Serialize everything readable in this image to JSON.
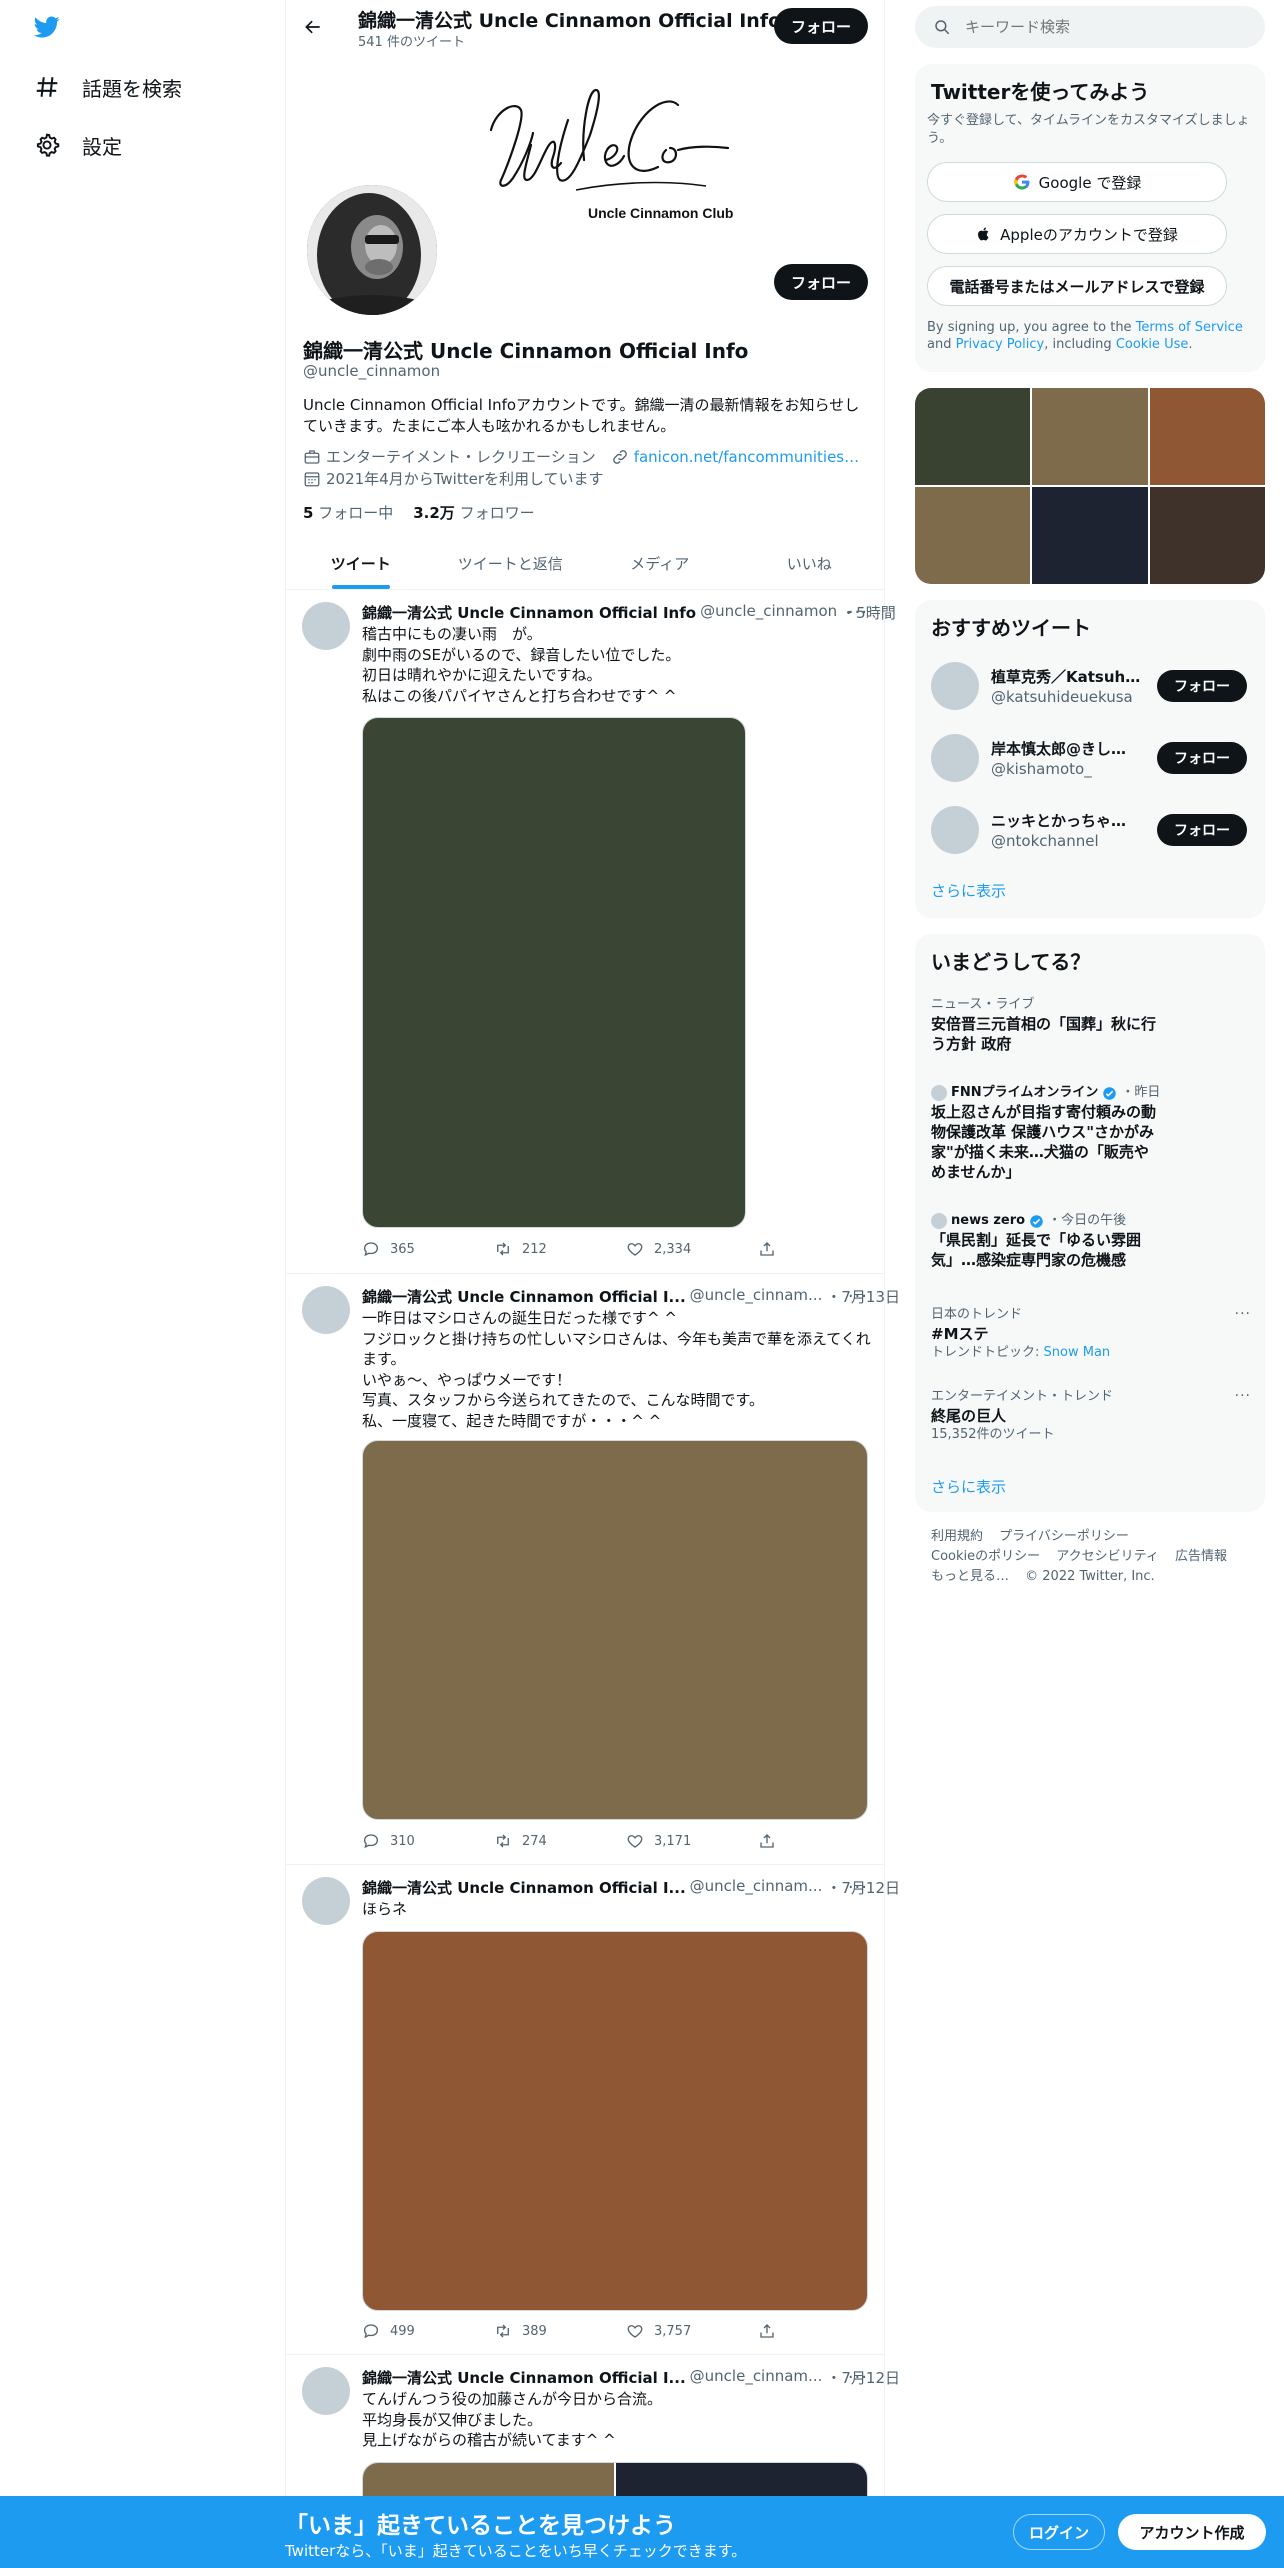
{
  "nav": {
    "items": [
      {
        "label": "話題を検索",
        "icon": "hashtag-icon"
      },
      {
        "label": "設定",
        "icon": "gear-icon"
      }
    ]
  },
  "header": {
    "name": "錦織一清公式 Uncle Cinnamon Official Info",
    "tweet_count": "541 件のツイート",
    "follow_label": "フォロー"
  },
  "banner": {
    "logo_text": "Uncle Cinnamon Club",
    "signature_text": "Uncle Co"
  },
  "profile": {
    "name": "錦織一清公式 Uncle Cinnamon Official Info",
    "handle": "@uncle_cinnamon",
    "bio": "Uncle Cinnamon Official Infoアカウントです。錦織一清の最新情報をお知らせしていきます。たまにご本人も呟かれるかもしれません。",
    "category": "エンターテイメント・レクリエーション",
    "url": "fanicon.net/fancommunities…",
    "joined": "2021年4月からTwitterを利用しています",
    "following_count": "5",
    "following_label": "フォロー中",
    "followers_count": "3.2万",
    "followers_label": "フォロワー",
    "follow_label": "フォロー"
  },
  "tabs": [
    "ツイート",
    "ツイートと返信",
    "メディア",
    "いいね"
  ],
  "tweets": [
    {
      "name": "錦織一清公式 Uncle Cinnamon Official Info",
      "handle": "@uncle_cinnamon",
      "time": "・5時間",
      "text": "稽古中にもの凄い雨　が。\n劇中雨のSEがいるので、録音したい位でした。\n初日は晴れやかに迎えたいですね。\n私はこの後パパイヤさんと打ち合わせです^ ^",
      "media_color": "#3b4533",
      "replies": "365",
      "retweets": "212",
      "likes": "2,334"
    },
    {
      "name": "錦織一清公式 Uncle Cinnamon Official I...",
      "handle": "@uncle_cinnam...",
      "time": "・7月13日",
      "text": "一昨日はマシロさんの誕生日だった様です^ ^\nフジロックと掛け持ちの忙しいマシロさんは、今年も美声で華を添えてくれます。\nいやぁ〜、やっぱウメーです！\n写真、スタッフから今送られてきたので、こんな時間です。\n私、一度寝て、起きた時間ですが・・・^ ^",
      "media_color": "#7d6b4c",
      "replies": "310",
      "retweets": "274",
      "likes": "3,171"
    },
    {
      "name": "錦織一清公式 Uncle Cinnamon Official I...",
      "handle": "@uncle_cinnam...",
      "time": "・7月12日",
      "text": "ほらネ",
      "media_color": "#8f5733",
      "replies": "499",
      "retweets": "389",
      "likes": "3,757"
    },
    {
      "name": "錦織一清公式 Uncle Cinnamon Official I...",
      "handle": "@uncle_cinnam...",
      "time": "・7月12日",
      "text": "てんげんつう役の加藤さんが今日から合流。\n平均身長が又伸びました。\n見上げながらの稽古が続いてます^ ^",
      "media_colors": [
        "#7d6b4c",
        "#1d2330"
      ]
    }
  ],
  "search": {
    "placeholder": "キーワード検索"
  },
  "signup_panel": {
    "title": "Twitterを使ってみよう",
    "subtitle": "今すぐ登録して、タイムラインをカスタマイズしましょう。",
    "google": "Google で登録",
    "apple": "Appleのアカウントで登録",
    "phone": "電話番号またはメールアドレスで登録",
    "terms_prefix": "By signing up, you agree to the ",
    "terms_link": "Terms of Service",
    "terms_and": " and ",
    "privacy_link": "Privacy Policy",
    "terms_including": ", including ",
    "cookie_link": "Cookie Use",
    "terms_end": "."
  },
  "media_grid": [
    "#394231",
    "#7d6b4c",
    "#8f5733",
    "#7d6b4c",
    "#1d2330",
    "#3e322a"
  ],
  "suggestions": {
    "title": "おすすめツイート",
    "items": [
      {
        "name": "植草克秀／Katsuhide...",
        "handle": "@katsuhideuekusa",
        "follow": "フォロー"
      },
      {
        "name": "岸本慎太郎@きしゃ...",
        "handle": "@kishamoto_",
        "follow": "フォロー"
      },
      {
        "name": "ニッキとかっちゃん...",
        "handle": "@ntokchannel",
        "follow": "フォロー"
      }
    ],
    "more": "さらに表示"
  },
  "trends": {
    "title": "いまどうしてる？",
    "items": [
      {
        "category": "ニュース・ライブ",
        "title": "安倍晋三元首相の「国葬」秋に行う方針 政府"
      },
      {
        "source": "FNNプライムオンライン",
        "time": "・昨日",
        "title": "坂上忍さんが目指す寄付頼みの動物保護改革 保護ハウス\"さかがみ家\"が描く未来…犬猫の「販売やめませんか」"
      },
      {
        "source": "news zero",
        "time": "・今日の午後",
        "title": "「県民割」延長で「ゆるい雰囲気」…感染症専門家の危機感"
      },
      {
        "category": "日本のトレンド",
        "title": "#Mステ",
        "sub_prefix": "トレンドトピック: ",
        "sub_link": "Snow Man"
      },
      {
        "category": "エンターテイメント・トレンド",
        "title": "終尾の巨人",
        "sub": "15,352件のツイート"
      }
    ],
    "more": "さらに表示"
  },
  "footer": {
    "links": [
      "利用規約",
      "プライバシーポリシー",
      "Cookieのポリシー",
      "アクセシビリティ",
      "広告情報",
      "もっと見る…"
    ],
    "copyright": "© 2022 Twitter, Inc."
  },
  "bottom_bar": {
    "title": "「いま」起きていることを見つけよう",
    "subtitle": "Twitterなら、「いま」起きていることをいち早くチェックできます。",
    "login": "ログイン",
    "signup": "アカウント作成"
  },
  "colors": {
    "accent": "#1d9bf0",
    "text": "#0f1419",
    "muted": "#536471",
    "panel": "#f7f9f9"
  }
}
